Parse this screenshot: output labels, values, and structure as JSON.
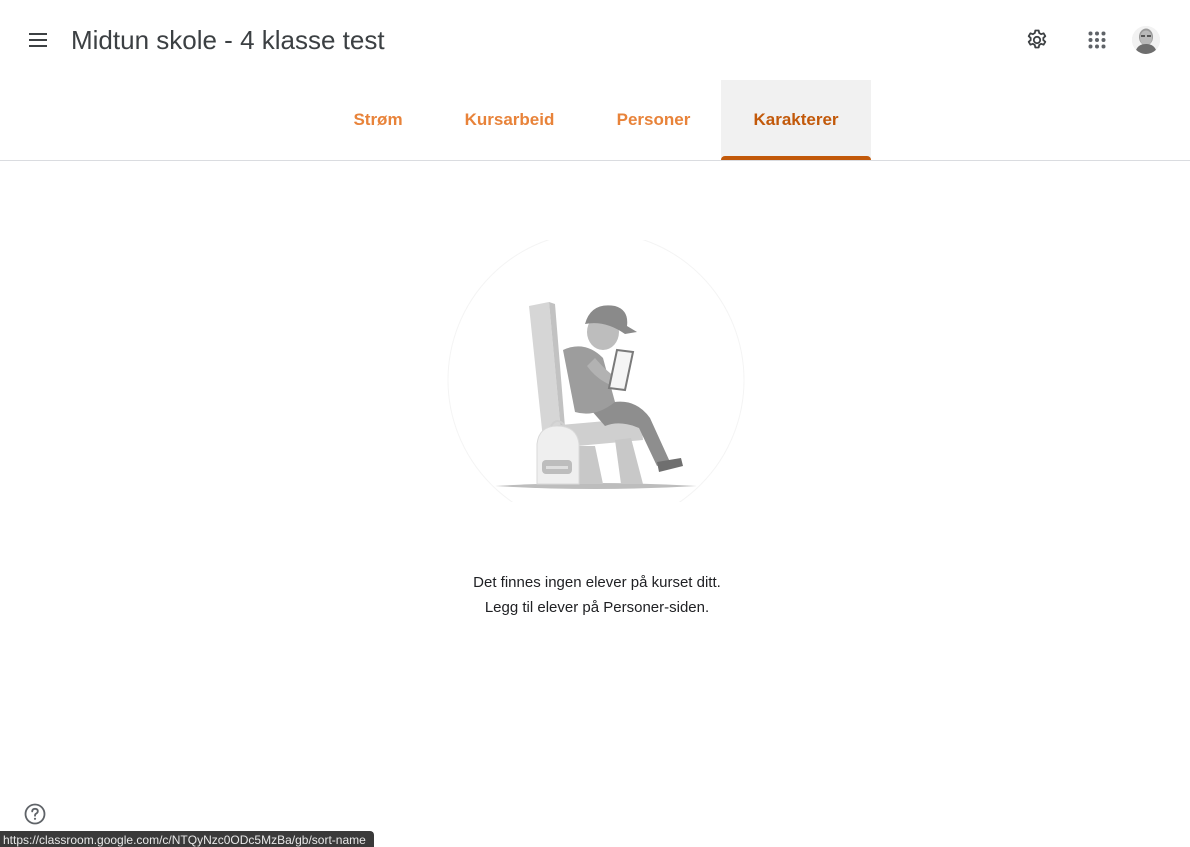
{
  "header": {
    "menu_icon": "hamburger-menu-icon",
    "course_title": "Midtun skole - 4 klasse test",
    "settings_icon": "gear-icon",
    "apps_icon": "apps-grid-icon",
    "avatar_icon": "user-avatar"
  },
  "tabs": [
    {
      "label": "Strøm",
      "active": false
    },
    {
      "label": "Kursarbeid",
      "active": false
    },
    {
      "label": "Personer",
      "active": false
    },
    {
      "label": "Karakterer",
      "active": true
    }
  ],
  "empty_state": {
    "line1": "Det finnes ingen elever på kurset ditt.",
    "line2": "Legg til elever på Personer-siden."
  },
  "footer": {
    "help_icon": "help-circle-icon",
    "status_url": "https://classroom.google.com/c/NTQyNzc0ODc5MzBa/gb/sort-name"
  },
  "colors": {
    "tab_accent": "#e8833a",
    "tab_active": "#c2590a",
    "title_text": "#3c4043"
  }
}
